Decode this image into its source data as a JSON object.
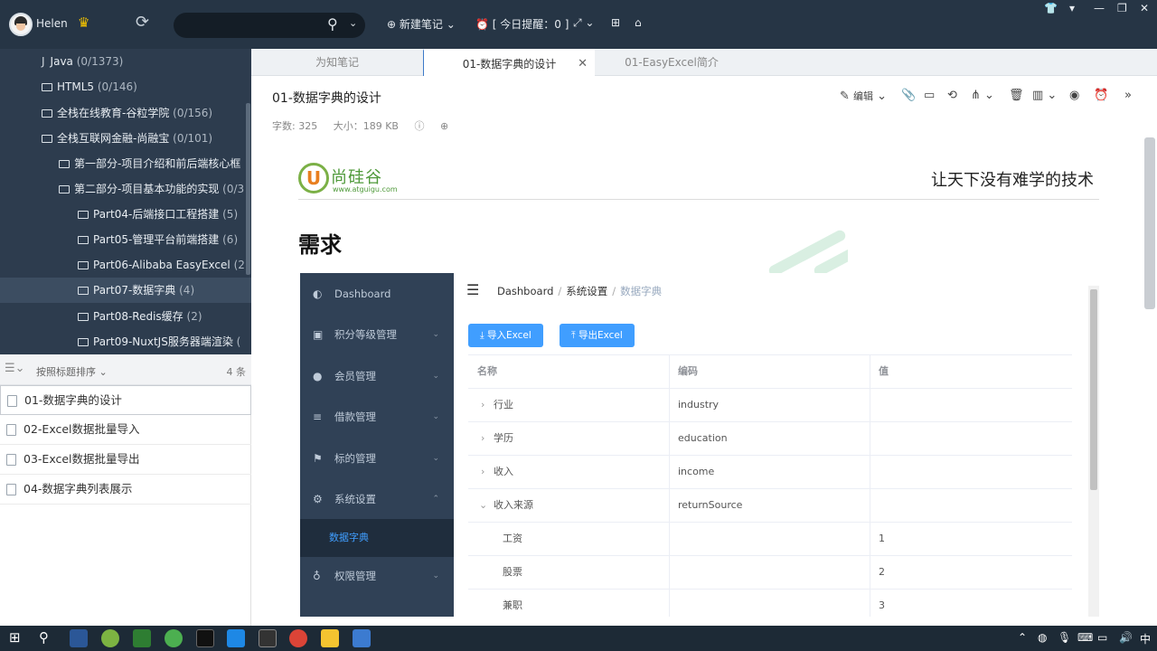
{
  "header": {
    "username": "Helen",
    "search_placeholder": "",
    "new_note": "新建笔记",
    "reminder": "[ 今日提醒：0 ]"
  },
  "tree": {
    "items": [
      {
        "label": "Java",
        "count": "(0/1373)"
      },
      {
        "label": "HTML5",
        "count": "(0/146)"
      },
      {
        "label": "全栈在线教育-谷粒学院",
        "count": "(0/156)"
      },
      {
        "label": "全栈互联网金融-尚融宝",
        "count": "(0/101)"
      },
      {
        "label": "第一部分-项目介绍和前后端核心框",
        "count": ""
      },
      {
        "label": "第二部分-项目基本功能的实现",
        "count": "(0/3"
      },
      {
        "label": "Part04-后端接口工程搭建",
        "count": "(5)"
      },
      {
        "label": "Part05-管理平台前端搭建",
        "count": "(6)"
      },
      {
        "label": "Part06-Alibaba EasyExcel",
        "count": "(2)"
      },
      {
        "label": "Part07-数据字典",
        "count": "(4)"
      },
      {
        "label": "Part08-Redis缓存",
        "count": "(2)"
      },
      {
        "label": "Part09-NuxtJS服务器端渲染",
        "count": "("
      }
    ]
  },
  "notelist": {
    "sort_label": "按照标题排序",
    "count": "4 条",
    "notes": [
      "01-数据字典的设计",
      "02-Excel数据批量导入",
      "03-Excel数据批量导出",
      "04-数据字典列表展示"
    ]
  },
  "tabs": [
    "为知笔记",
    "01-数据字典的设计",
    "01-EasyExcel简介"
  ],
  "doc": {
    "title": "01-数据字典的设计",
    "word_count": "字数: 325",
    "size": "大小：189 KB",
    "edit": "编辑",
    "logo_name": "尚硅谷",
    "logo_letter": "U",
    "logo_url": "www.atguigu.com",
    "slogan": "让天下没有难学的技术",
    "heading": "需求"
  },
  "admin": {
    "menu": [
      {
        "label": "Dashboard",
        "icon": "dashboard-icon"
      },
      {
        "label": "积分等级管理",
        "icon": "list-icon"
      },
      {
        "label": "会员管理",
        "icon": "user-icon"
      },
      {
        "label": "借款管理",
        "icon": "menu-icon"
      },
      {
        "label": "标的管理",
        "icon": "flag-icon"
      },
      {
        "label": "系统设置",
        "icon": "gear-icon"
      },
      {
        "label": "权限管理",
        "icon": "lock-icon"
      }
    ],
    "submenu_active": "数据字典",
    "breadcrumb": [
      "Dashboard",
      "系统设置",
      "数据字典"
    ],
    "import_btn": "导入Excel",
    "export_btn": "导出Excel",
    "columns": [
      "名称",
      "编码",
      "值"
    ],
    "rows": [
      {
        "name": "行业",
        "code": "industry",
        "value": "",
        "expander": "›"
      },
      {
        "name": "学历",
        "code": "education",
        "value": "",
        "expander": "›"
      },
      {
        "name": "收入",
        "code": "income",
        "value": "",
        "expander": "›"
      },
      {
        "name": "收入来源",
        "code": "returnSource",
        "value": "",
        "expander": "⌄"
      },
      {
        "name": "工资",
        "code": "",
        "value": "1",
        "expander": ""
      },
      {
        "name": "股票",
        "code": "",
        "value": "2",
        "expander": ""
      },
      {
        "name": "兼职",
        "code": "",
        "value": "3",
        "expander": ""
      }
    ]
  },
  "tray": {
    "ime": "中"
  }
}
